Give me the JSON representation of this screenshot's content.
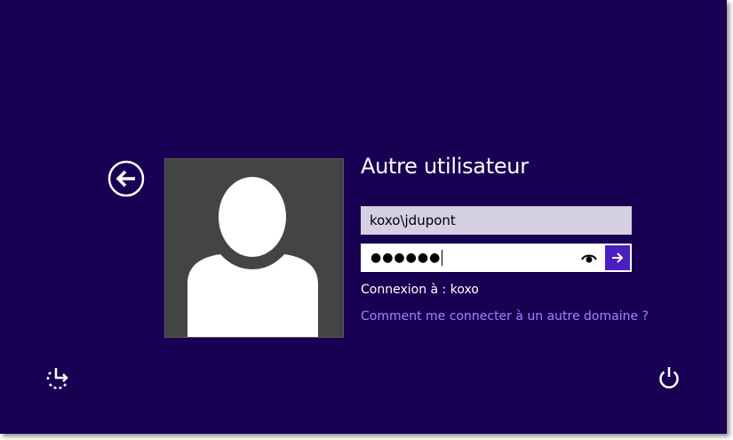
{
  "login": {
    "title": "Autre utilisateur",
    "username_value": "koxo\\jdupont",
    "password_mask": "●●●●●●",
    "connection_label": "Connexion à : koxo",
    "other_domain_link": "Comment me connecter à un autre domaine ?"
  },
  "icons": {
    "back": "back-arrow-icon",
    "avatar": "user-silhouette-icon",
    "reveal": "eye-icon",
    "submit": "arrow-right-icon",
    "ease_of_access": "ease-of-access-icon",
    "power": "power-icon"
  },
  "colors": {
    "background": "#180052",
    "accent": "#4a1fbf",
    "link": "#9f86ff",
    "username_field_bg": "#d6d0e3",
    "avatar_bg": "#444444"
  }
}
